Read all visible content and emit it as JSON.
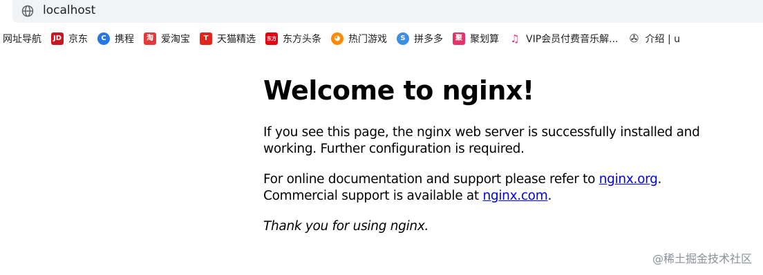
{
  "browser": {
    "address": "localhost",
    "bookmarks": [
      {
        "label": "网址导航",
        "icon": "none"
      },
      {
        "label": "京东",
        "icon": "jd-icon",
        "glyph": "JD",
        "color": "#c81623"
      },
      {
        "label": "携程",
        "icon": "ctrip-icon",
        "glyph": "C",
        "color": "#2577e3"
      },
      {
        "label": "爱淘宝",
        "icon": "taobao-icon",
        "glyph": "淘",
        "color": "#e4393c"
      },
      {
        "label": "天猫精选",
        "icon": "tmall-icon",
        "glyph": "T",
        "color": "#e1251b"
      },
      {
        "label": "东方头条",
        "icon": "dftt-icon",
        "glyph": "东方",
        "color": "#e60012"
      },
      {
        "label": "热门游戏",
        "icon": "game-icon",
        "glyph": "◕",
        "color": "#ff8a00"
      },
      {
        "label": "拼多多",
        "icon": "pinduoduo-icon",
        "glyph": "S",
        "color": "#3b8de5"
      },
      {
        "label": "聚划算",
        "icon": "juhuasuan-icon",
        "glyph": "聚",
        "color": "#e2336b"
      },
      {
        "label": "VIP会员付费音乐解...",
        "icon": "music-icon",
        "glyph": "♫",
        "color": "#ffffff"
      },
      {
        "label": "介绍 | u",
        "icon": "logo-icon",
        "glyph": "✇",
        "color": "#ffffff"
      }
    ]
  },
  "page": {
    "heading": "Welcome to nginx!",
    "p1": "If you see this page, the nginx web server is successfully installed and working. Further configuration is required.",
    "p2_text": "For online documentation and support please refer to ",
    "p2_link": "nginx.org",
    "p2_mid": ".",
    "p2_text2": "Commercial support is available at ",
    "p2_link2": "nginx.com",
    "p2_end": ".",
    "p3": "Thank you for using nginx."
  },
  "watermark": "@稀土掘金技术社区"
}
